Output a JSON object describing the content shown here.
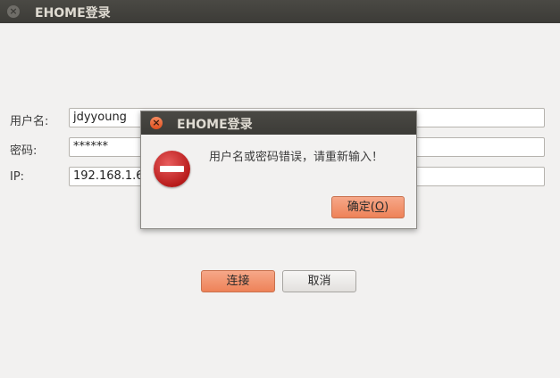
{
  "window": {
    "title": "EHOME登录",
    "close_glyph": "×"
  },
  "form": {
    "username_label": "用户名:",
    "username_value": "jdyyoung",
    "password_label": "密码:",
    "password_value": "******",
    "ip_label": "IP:",
    "ip_value": "192.168.1.6"
  },
  "buttons": {
    "connect": "连接",
    "cancel": "取消"
  },
  "dialog": {
    "title": "EHOME登录",
    "close_glyph": "×",
    "icon": "error-icon",
    "message": "用户名或密码错误，请重新输入！",
    "ok_prefix": "确定(",
    "ok_mnemonic": "O",
    "ok_suffix": ")"
  },
  "colors": {
    "accent": "#ee8258",
    "titlebar": "#3c3b37",
    "error": "#b81b1b"
  }
}
